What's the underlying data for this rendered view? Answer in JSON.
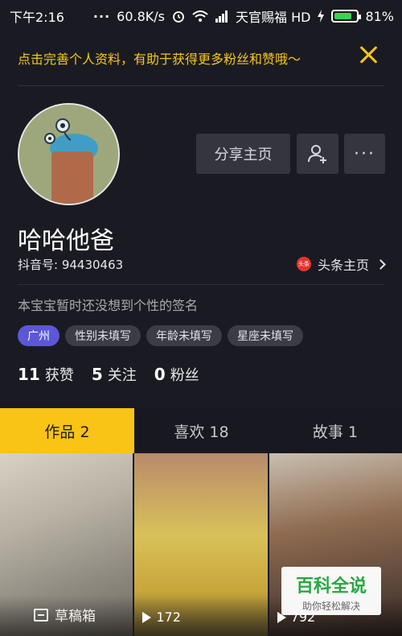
{
  "status_bar": {
    "time": "下午2:16",
    "network_speed": "60.8K/s",
    "carrier": "天官赐福 HD",
    "battery_percent": "81%",
    "battery_level": 0.81,
    "icons": [
      "alarm-icon",
      "wifi-icon",
      "signal-icon",
      "charging-icon",
      "battery-icon"
    ]
  },
  "notice": {
    "text": "点击完善个人资料，有助于获得更多粉丝和赞哦～"
  },
  "profile": {
    "share_label": "分享主页",
    "name": "哈哈他爸",
    "douyin_id": "抖音号: 94430463",
    "toutiao_icon_text": "头条",
    "toutiao_label": "头条主页",
    "signature": "本宝宝暂时还没想到个性的签名",
    "tags": [
      "广州",
      "性别未填写",
      "年龄未填写",
      "星座未填写"
    ],
    "stats": [
      {
        "count": "11",
        "label": "获赞"
      },
      {
        "count": "5",
        "label": "关注"
      },
      {
        "count": "0",
        "label": "粉丝"
      }
    ]
  },
  "tabs": [
    {
      "label": "作品 2",
      "active": true
    },
    {
      "label": "喜欢 18",
      "active": false
    },
    {
      "label": "故事 1",
      "active": false
    }
  ],
  "videos": [
    {
      "draft_label": "草稿箱"
    },
    {
      "play_count": "172"
    },
    {
      "play_count": "792"
    }
  ],
  "watermark": {
    "title": "百科全说",
    "subtitle": "助你轻松解决"
  },
  "colors": {
    "accent": "#f8c415",
    "background": "#1a1b22",
    "city_tag": "#5b57d6",
    "notice_text": "#f6c61a"
  }
}
